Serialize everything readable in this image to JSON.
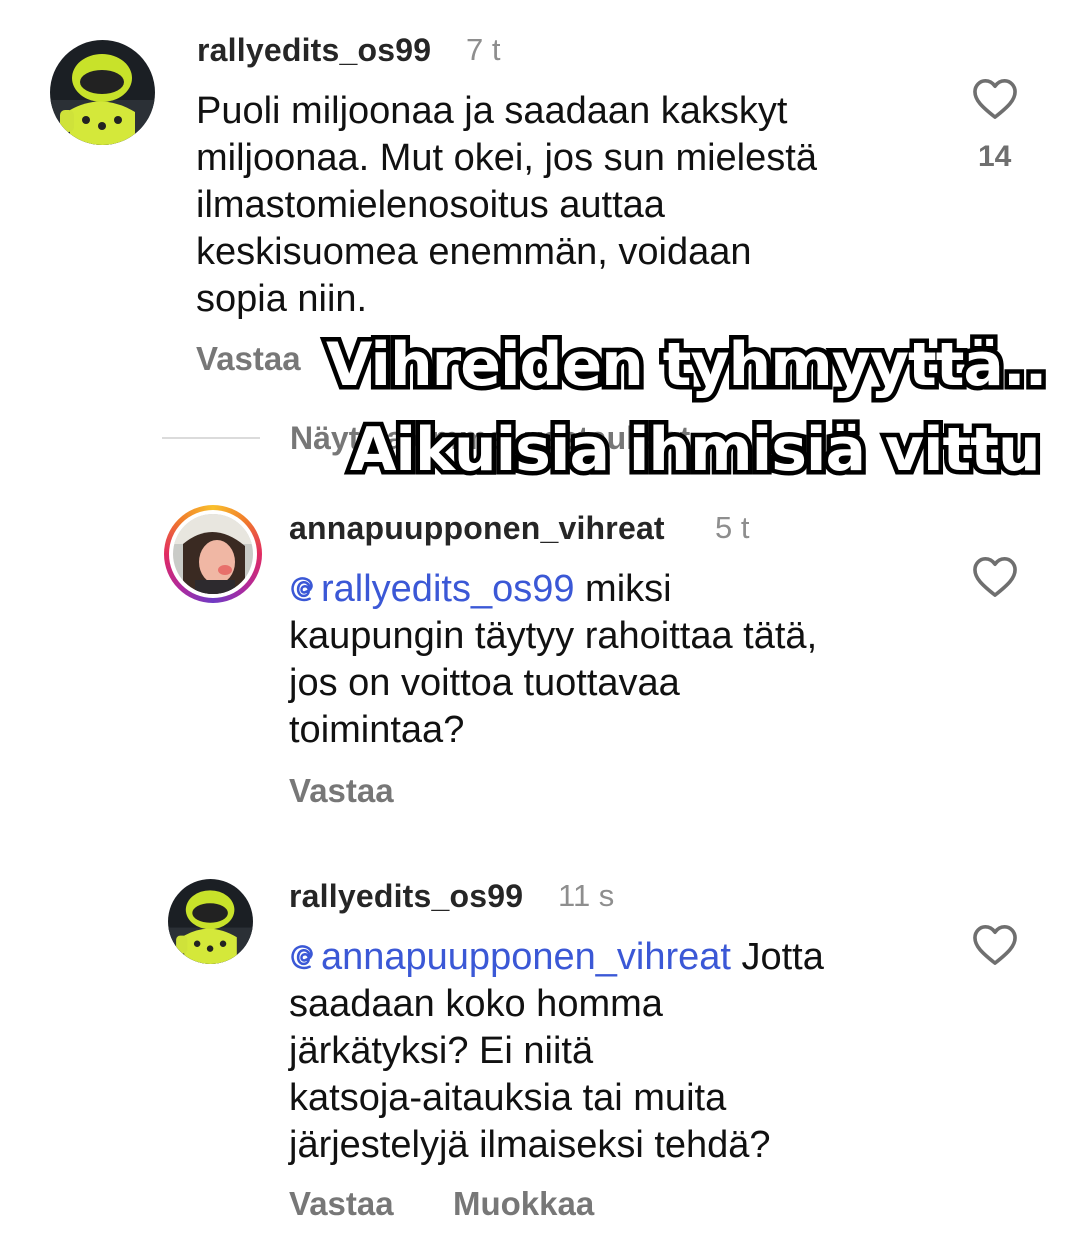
{
  "comments": [
    {
      "username": "rallyedits_os99",
      "time": "7 t",
      "lines": [
        "Puoli miljoonaa ja saadaan kakskyt",
        "miljoonaa. Mut okei, jos sun mielestä",
        "ilmastomielenosoitus auttaa",
        "keskisuomea enemmän, voidaan",
        "sopia niin."
      ],
      "reply_label": "Vastaa",
      "like_count": "14",
      "avatar_icon": "helmet-avatar"
    },
    {
      "username": "annapuupponen_vihreat",
      "time": "5 t",
      "mention": "rallyedits_os99",
      "first_line_rest": " miksi",
      "lines": [
        "kaupungin täytyy rahoittaa tätä,",
        "jos on voittoa tuottavaa",
        "toimintaa?"
      ],
      "reply_label": "Vastaa",
      "avatar_icon": "portrait-avatar"
    },
    {
      "username": "rallyedits_os99",
      "time": "11 s",
      "mention": "annapuupponen_vihreat",
      "first_line_rest": " Jotta",
      "lines": [
        "saadaan koko homma",
        "järkätyksi? Ei niitä",
        "katsoja-aitauksia tai muita",
        "järjestelyjä ilmaiseksi tehdä?"
      ],
      "reply_label": "Vastaa",
      "edit_label": "Muokkaa",
      "avatar_icon": "helmet-avatar"
    }
  ],
  "view_replies": "Näytä aiemmat vastaukset",
  "overlay": {
    "line1": "Vihreiden tyhmyyttä..",
    "line2": "Aikuisia ihmisiä vittu"
  },
  "colors": {
    "mention": "#3b58d6",
    "secondary_text": "#8e8e8e",
    "action_text": "#777777"
  },
  "icons": {
    "like": "heart-outline-icon",
    "mention": "threads-at-icon"
  }
}
